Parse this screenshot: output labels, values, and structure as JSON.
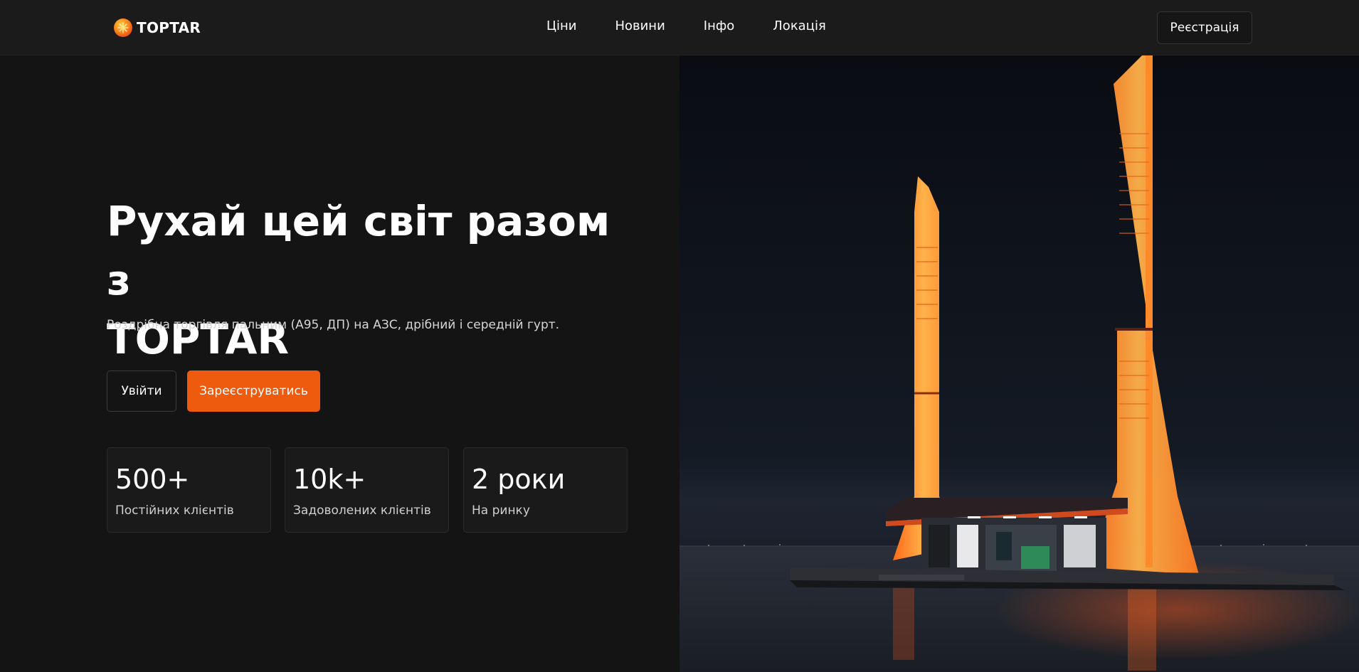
{
  "header": {
    "brand": "TOPTAR",
    "logo_icon": "sun-burst-logo-icon",
    "nav": [
      {
        "label": "Ціни"
      },
      {
        "label": "Новини"
      },
      {
        "label": "Інфо"
      },
      {
        "label": "Локація"
      }
    ],
    "register_label": "Реєстрація"
  },
  "hero": {
    "title_line1": "Рухай цей світ разом з",
    "title_line2": "TOPTAR",
    "subtitle": "Роздрібна торгівля пальним (А95, ДП) на АЗС, дрібний і середній гурт.",
    "login_label": "Увійти",
    "signup_label": "Зареєструватись",
    "stats": [
      {
        "value": "500+",
        "label": "Постійних клієнтів"
      },
      {
        "value": "10k+",
        "label": "Задоволених клієнтів"
      },
      {
        "value": "2 роки",
        "label": "На ринку"
      }
    ],
    "image": "neon-gas-station-illustration"
  },
  "colors": {
    "accent": "#ee5a0e",
    "background": "#141414",
    "navbar": "#1b1b1b"
  }
}
